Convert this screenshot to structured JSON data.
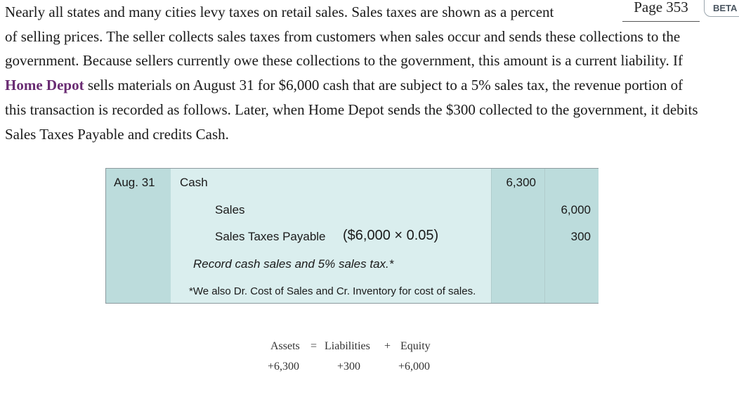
{
  "page": {
    "label": "Page 353",
    "badge": "BETA"
  },
  "paragraph": {
    "line1": "Nearly all states and many cities levy taxes on retail sales. Sales taxes are shown as a percent",
    "before_company": "of selling prices. The seller collects sales taxes from customers when sales occur and sends these collections to the government. Because sellers currently owe these collections to the government, this amount is a current liability. If ",
    "company": "Home Depot",
    "after_company": " sells materials on August 31 for $6,000 cash that are subject to a 5% sales tax, the revenue portion of this transaction is recorded as follows. Later, when Home Depot sends the $300 collected to the government, it debits Sales Taxes Payable and credits Cash."
  },
  "journal": {
    "date": "Aug. 31",
    "debit_account": "Cash",
    "debit_amount": "6,300",
    "credit1_account": "Sales",
    "credit1_amount": "6,000",
    "credit2_account": "Sales Taxes Payable",
    "credit2_calc": "($6,000 × 0.05)",
    "credit2_amount": "300",
    "memo": "Record cash sales and 5% sales tax.*",
    "footnote": "*We also Dr. Cost of Sales and Cr. Inventory for cost of sales."
  },
  "equation": {
    "assets_label": "Assets",
    "equals": "=",
    "liabilities_label": "Liabilities",
    "plus": "+",
    "equity_label": "Equity",
    "assets_value": "+6,300",
    "liabilities_value": "+300",
    "equity_value": "+6,000"
  }
}
